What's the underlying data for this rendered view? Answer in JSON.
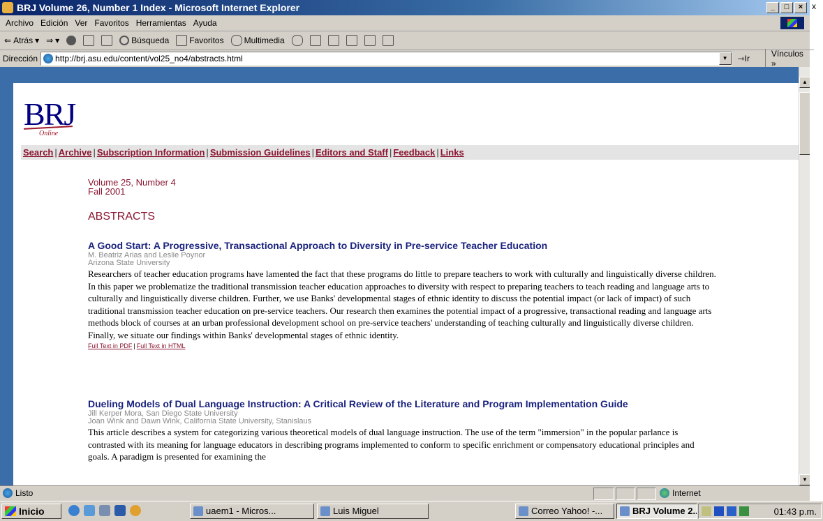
{
  "window": {
    "title": "BRJ Volume 26, Number 1 Index - Microsoft Internet Explorer",
    "offscreen_char": "x"
  },
  "menubar": [
    "Archivo",
    "Edición",
    "Ver",
    "Favoritos",
    "Herramientas",
    "Ayuda"
  ],
  "toolbar": {
    "back": "Atrás",
    "search": "Búsqueda",
    "favorites": "Favoritos",
    "multimedia": "Multimedia"
  },
  "address": {
    "label": "Dirección",
    "url": "http://brj.asu.edu/content/vol25_no4/abstracts.html",
    "go": "Ir",
    "links": "Vínculos"
  },
  "page": {
    "logo_text": "BRJ",
    "logo_sub": "Online",
    "nav": [
      "Search",
      "Archive",
      "Subscription Information",
      "Submission Guidelines",
      "Editors and Staff",
      "Feedback",
      "Links"
    ],
    "volume": "Volume 25, Number 4",
    "season": "Fall 2001",
    "heading": "ABSTRACTS",
    "articles": [
      {
        "title": "A Good Start: A Progressive, Transactional Approach to Diversity in Pre-service Teacher Education",
        "authors": "M. Beatriz Arias and Leslie Poynor",
        "affiliation": "Arizona State University",
        "abstract": "Researchers of teacher education programs have lamented the fact that these programs do little to prepare teachers to work with culturally and linguistically diverse children. In this paper we problematize the traditional transmission teacher education approaches to diversity with respect to preparing teachers to teach reading and language arts to culturally and linguistically diverse children. Further, we use Banks' developmental stages of ethnic identity to discuss the potential impact (or lack of impact) of such traditional transmission teacher education on pre-service teachers. Our research then examines the potential impact of a progressive, transactional reading and language arts methods block of courses at an urban professional development school on pre-service teachers' understanding of teaching culturally and linguistically diverse children. Finally, we situate our findings within Banks' developmental stages of ethnic identity.",
        "link_pdf": "Full Text in PDF",
        "link_html": "Full Text in HTML"
      },
      {
        "title": "Dueling Models of Dual Language Instruction: A Critical Review of the Literature and Program Implementation Guide",
        "authors": "Jill Kerper Mora, San Diego State University",
        "affiliation": "Joan Wink and Dawn Wink, California State University, Stanislaus",
        "abstract": "This article describes a system for categorizing various theoretical models of dual language instruction. The use of the term \"immersion\" in the popular parlance is contrasted with its meaning for language educators in describing programs implemented to conform to specific enrichment or compensatory educational principles and goals. A paradigm is presented for examining the"
      }
    ]
  },
  "status": {
    "text": "Listo",
    "zone": "Internet"
  },
  "taskbar": {
    "start": "Inicio",
    "tasks": [
      "uaem1 - Micros...",
      "Luis Miguel",
      "Correo Yahoo! -...",
      "BRJ Volume 2..."
    ],
    "clock": "01:43 p.m."
  },
  "colors": {
    "accent": "#8a1530",
    "title_blue": "#1a237e",
    "frame_blue": "#3b6ea8"
  }
}
